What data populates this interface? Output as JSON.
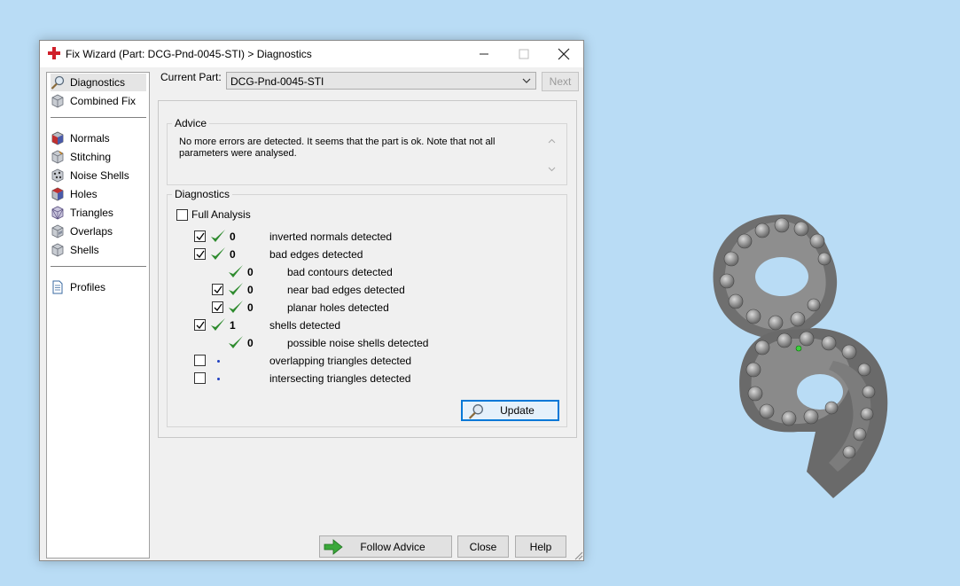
{
  "window": {
    "title": "Fix Wizard (Part: DCG-Pnd-0045-STI) > Diagnostics",
    "minimize_glyph": "—",
    "maximize_glyph": "☐",
    "close_glyph": "✕"
  },
  "sidebar": {
    "items": [
      {
        "label": "Diagnostics",
        "icon": "magnifier-icon",
        "selected": true
      },
      {
        "label": "Combined Fix",
        "icon": "cube-icon"
      },
      {
        "label": "Normals",
        "icon": "normals-cube-icon"
      },
      {
        "label": "Stitching",
        "icon": "stitching-cube-icon"
      },
      {
        "label": "Noise Shells",
        "icon": "noise-shells-icon"
      },
      {
        "label": "Holes",
        "icon": "holes-cube-icon"
      },
      {
        "label": "Triangles",
        "icon": "triangles-cube-icon"
      },
      {
        "label": "Overlaps",
        "icon": "overlaps-cube-icon"
      },
      {
        "label": "Shells",
        "icon": "shells-cube-icon"
      },
      {
        "label": "Profiles",
        "icon": "document-icon"
      }
    ]
  },
  "header": {
    "current_part_label": "Current Part:",
    "current_part_value": "DCG-Pnd-0045-STI",
    "next_label": "Next"
  },
  "advice": {
    "title": "Advice",
    "text": "No more errors are detected. It seems that the part is ok. Note that not all parameters were analysed."
  },
  "diagnostics": {
    "title": "Diagnostics",
    "full_analysis_label": "Full Analysis",
    "full_analysis_checked": false,
    "rows": [
      {
        "checkbox": true,
        "checked": true,
        "status": "ok",
        "count": "0",
        "label": "inverted normals detected",
        "indent": 0
      },
      {
        "checkbox": true,
        "checked": true,
        "status": "ok",
        "count": "0",
        "label": "bad edges detected",
        "indent": 0
      },
      {
        "checkbox": false,
        "checked": false,
        "status": "ok",
        "count": "0",
        "label": "bad contours detected",
        "indent": 1
      },
      {
        "checkbox": true,
        "checked": true,
        "status": "ok",
        "count": "0",
        "label": "near bad edges detected",
        "indent": 1
      },
      {
        "checkbox": true,
        "checked": true,
        "status": "ok",
        "count": "0",
        "label": "planar holes detected",
        "indent": 1
      },
      {
        "checkbox": true,
        "checked": true,
        "status": "ok",
        "count": "1",
        "label": "shells detected",
        "indent": 0
      },
      {
        "checkbox": false,
        "checked": false,
        "status": "ok",
        "count": "0",
        "label": "possible noise shells detected",
        "indent": 1
      },
      {
        "checkbox": true,
        "checked": false,
        "status": "unknown",
        "count": "",
        "label": "overlapping triangles detected",
        "indent": 0
      },
      {
        "checkbox": true,
        "checked": false,
        "status": "unknown",
        "count": "",
        "label": "intersecting triangles detected",
        "indent": 0
      }
    ],
    "update_label": "Update"
  },
  "footer": {
    "follow_advice_label": "Follow Advice",
    "close_label": "Close",
    "help_label": "Help"
  },
  "colors": {
    "desktop": "#b9dcf5",
    "check_green": "#2e8b2e",
    "accent_blue": "#0078d7"
  }
}
